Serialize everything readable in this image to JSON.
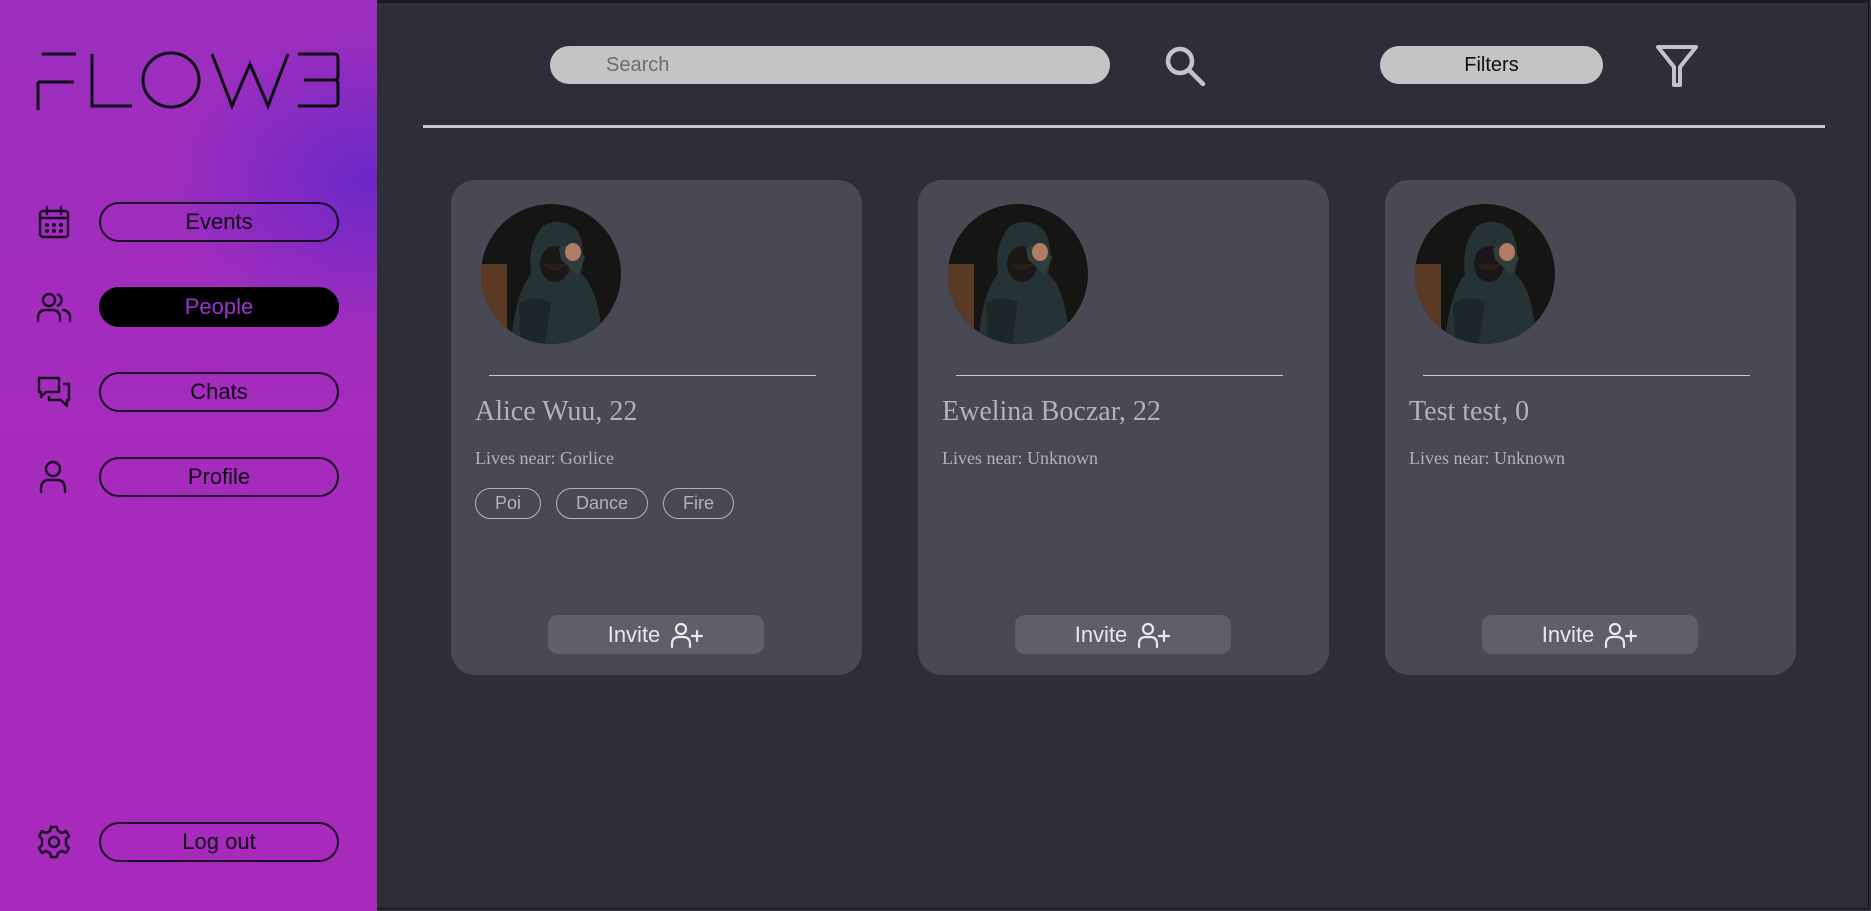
{
  "app": {
    "logo_text": "FLOW3"
  },
  "sidebar": {
    "items": [
      {
        "label": "Events",
        "icon": "calendar-icon",
        "active": false
      },
      {
        "label": "People",
        "icon": "people-icon",
        "active": true
      },
      {
        "label": "Chats",
        "icon": "chat-icon",
        "active": false
      },
      {
        "label": "Profile",
        "icon": "user-icon",
        "active": false
      }
    ],
    "logout": {
      "label": "Log out",
      "icon": "gear-icon"
    }
  },
  "header": {
    "search_placeholder": "Search",
    "filters_label": "Filters"
  },
  "people": [
    {
      "name": "Alice Wuu, 22",
      "location": "Lives near: Gorlice",
      "tags": [
        "Poi",
        "Dance",
        "Fire"
      ],
      "invite_label": "Invite"
    },
    {
      "name": "Ewelina Boczar, 22",
      "location": "Lives near: Unknown",
      "tags": [],
      "invite_label": "Invite"
    },
    {
      "name": "Test test, 0",
      "location": "Lives near: Unknown",
      "tags": [],
      "invite_label": "Invite"
    }
  ],
  "colors": {
    "sidebar_gradient_start": "#9b2fbe",
    "sidebar_accent": "#6828c8",
    "active_text": "#9b34d2",
    "background": "#2e2e37",
    "card": "#494953"
  }
}
